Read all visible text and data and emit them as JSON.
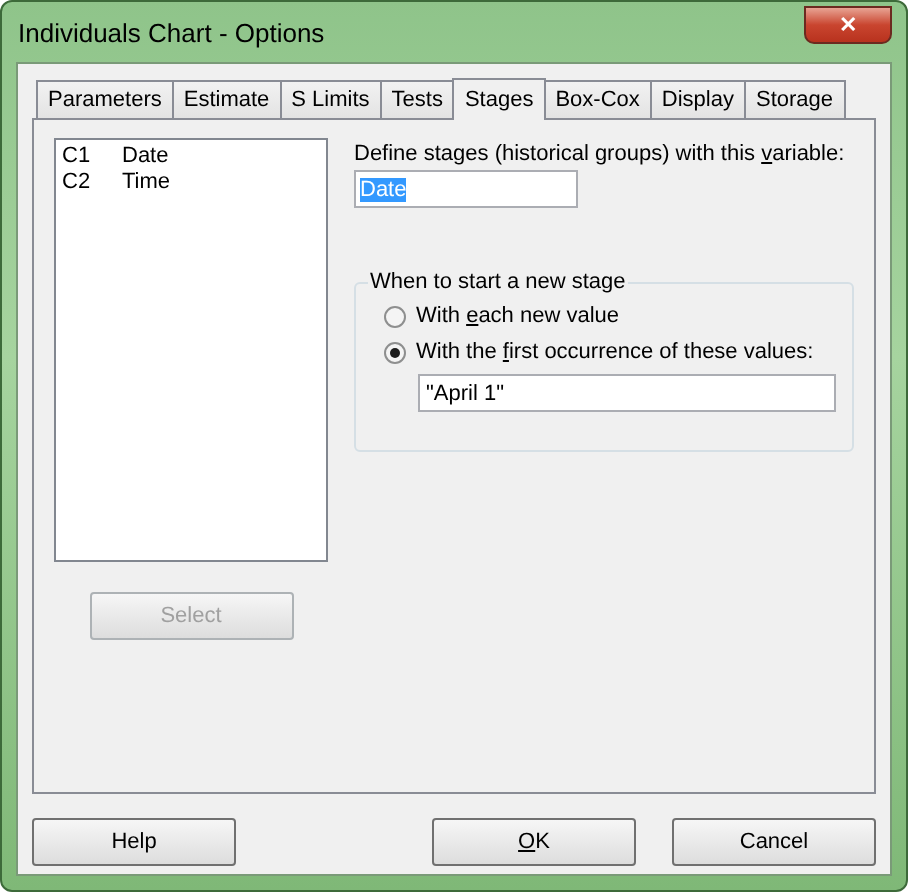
{
  "window": {
    "title": "Individuals Chart - Options",
    "close": "✕"
  },
  "tabs": [
    {
      "label": "Parameters",
      "selected": false
    },
    {
      "label": "Estimate",
      "selected": false
    },
    {
      "label": "S Limits",
      "selected": false
    },
    {
      "label": "Tests",
      "selected": false
    },
    {
      "label": "Stages",
      "selected": true
    },
    {
      "label": "Box-Cox",
      "selected": false
    },
    {
      "label": "Display",
      "selected": false
    },
    {
      "label": "Storage",
      "selected": false
    }
  ],
  "columns": [
    {
      "id": "C1",
      "name": "Date"
    },
    {
      "id": "C2",
      "name": "Time"
    }
  ],
  "select_button": {
    "label": "Select",
    "disabled": true
  },
  "variable": {
    "label_parts": [
      "Define stages (historical groups) with this ",
      "v",
      "ariable:"
    ],
    "value": "Date"
  },
  "stage_group": {
    "title": "When to start a new stage",
    "options": [
      {
        "label_parts": [
          "With ",
          "e",
          "ach new value"
        ],
        "selected": false
      },
      {
        "label_parts": [
          "With the ",
          "f",
          "irst occurrence of these values:"
        ],
        "selected": true
      }
    ],
    "values": "\"April 1\""
  },
  "buttons": [
    {
      "label_parts": [
        "Help"
      ]
    },
    {
      "label_parts": [
        "O",
        "K"
      ]
    },
    {
      "label_parts": [
        "Cancel"
      ]
    }
  ]
}
